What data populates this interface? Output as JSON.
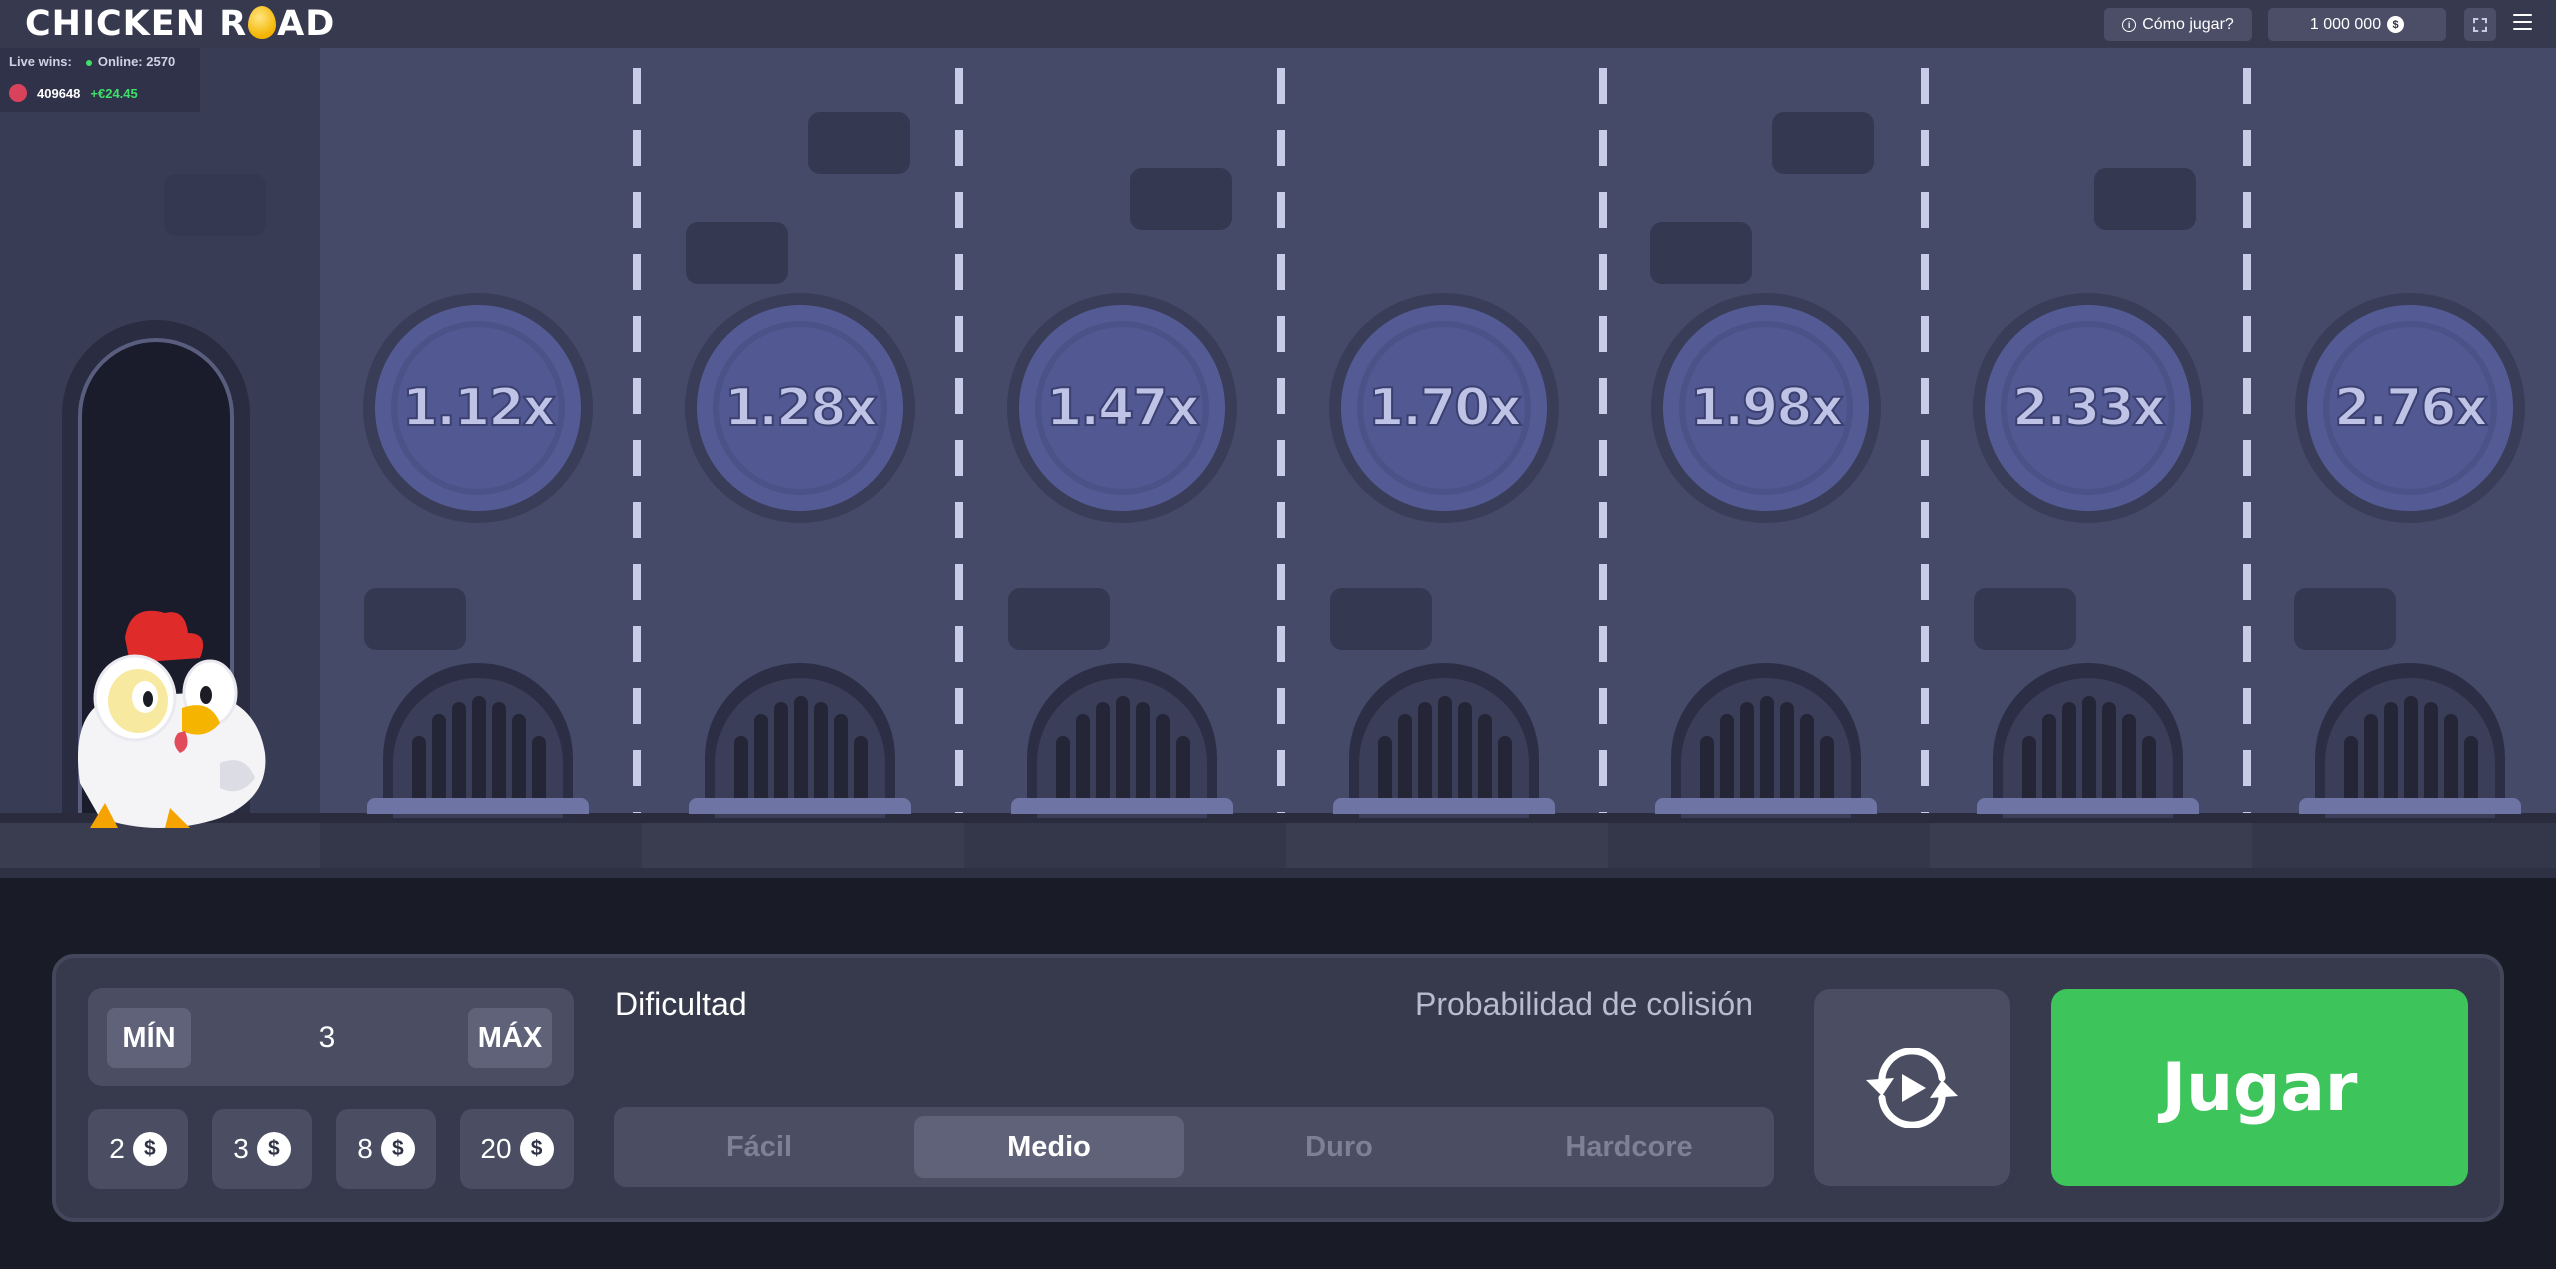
{
  "header": {
    "logo_left": "CHICKEN R",
    "logo_right": "AD",
    "how_to_play": "Cómo jugar?",
    "balance": "1 000 000"
  },
  "live": {
    "live_wins_label": "Live wins:",
    "online_label": "Online:",
    "online_count": "2570",
    "last_win_user": "409648",
    "last_win_amount": "+€24.45"
  },
  "lanes": [
    {
      "multiplier": "1.12x"
    },
    {
      "multiplier": "1.28x"
    },
    {
      "multiplier": "1.47x"
    },
    {
      "multiplier": "1.70x"
    },
    {
      "multiplier": "1.98x"
    },
    {
      "multiplier": "2.33x"
    },
    {
      "multiplier": "2.76x"
    }
  ],
  "controls": {
    "min_label": "MÍN",
    "max_label": "MÁX",
    "bet_value": "3",
    "quick_bets": [
      "2",
      "3",
      "8",
      "20"
    ],
    "currency_icon": "$",
    "difficulty_label": "Dificultad",
    "collision_label": "Probabilidad de colisión",
    "difficulties": [
      "Fácil",
      "Medio",
      "Duro",
      "Hardcore"
    ],
    "selected_difficulty": "Medio",
    "play_label": "Jugar"
  },
  "colors": {
    "play_green": "#3dc45a",
    "win_green": "#3ee06a",
    "lane_bg": "#464a69",
    "panel_bg": "#373a4c"
  }
}
